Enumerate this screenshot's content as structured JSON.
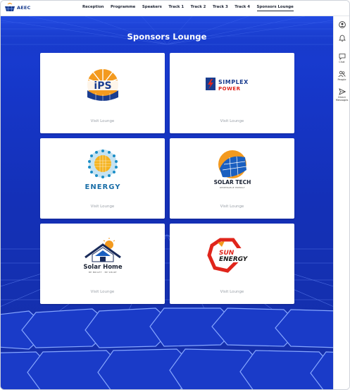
{
  "app": {
    "brand_name": "AEEC"
  },
  "nav": {
    "items": [
      {
        "label": "Reception",
        "active": false
      },
      {
        "label": "Programme",
        "active": false
      },
      {
        "label": "Speakers",
        "active": false
      },
      {
        "label": "Track 1",
        "active": false
      },
      {
        "label": "Track 2",
        "active": false
      },
      {
        "label": "Track 3",
        "active": false
      },
      {
        "label": "Track 4",
        "active": false
      },
      {
        "label": "Sponsors Lounge",
        "active": true
      }
    ]
  },
  "page": {
    "title": "Sponsors Lounge"
  },
  "sponsors": [
    {
      "logo": "ips-logo",
      "logo_text": "iPS",
      "action": "Visit Lounge"
    },
    {
      "logo": "simplex-power-logo",
      "logo_text": "SIMPLEX",
      "logo_text2": "POWER",
      "action": "Visit Lounge"
    },
    {
      "logo": "energy-logo",
      "logo_text": "ENERGY",
      "action": "Visit Lounge"
    },
    {
      "logo": "solar-tech-logo",
      "logo_text": "SOLAR TECH",
      "logo_subtext": "RENEWABLE ENERGY",
      "action": "Visit Lounge"
    },
    {
      "logo": "solar-home-logo",
      "logo_text": "Solar Home",
      "logo_subtext": "BE BRIGHT · BE SMART",
      "action": "Visit Lounge"
    },
    {
      "logo": "sun-energy-logo",
      "logo_text": "SUN",
      "logo_text2": "ENERGY",
      "action": "Visit Lounge"
    }
  ],
  "rail": {
    "items": [
      {
        "icon": "user-icon",
        "label": ""
      },
      {
        "icon": "bell-icon",
        "label": ""
      },
      {
        "icon": "chat-icon",
        "label": "Chat"
      },
      {
        "icon": "people-icon",
        "label": "People"
      },
      {
        "icon": "send-icon",
        "label": "Direct Messages"
      }
    ]
  },
  "colors": {
    "background_blue": "#1637c9",
    "card": "#ffffff",
    "brand_navy": "#1a3d8f",
    "accent_orange": "#f39a1f",
    "accent_red": "#e0251b"
  }
}
